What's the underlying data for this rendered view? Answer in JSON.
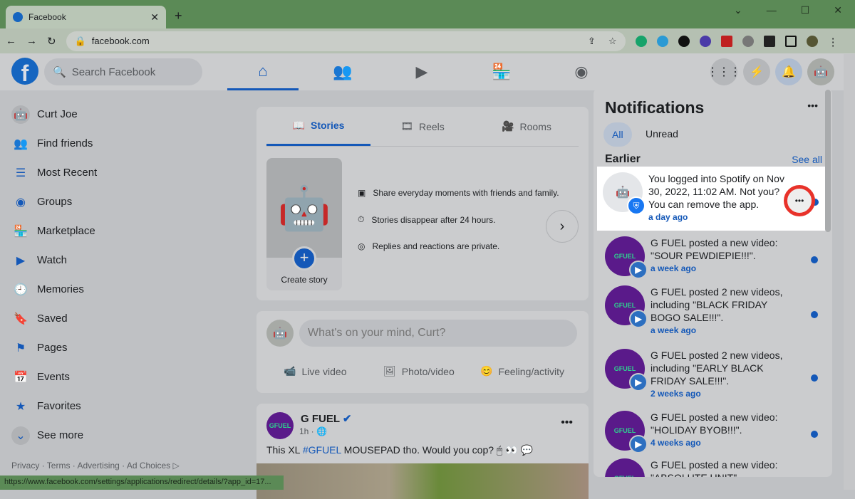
{
  "browser": {
    "tab_title": "Facebook",
    "url": "facebook.com",
    "status_url": "https://www.facebook.com/settings/applications/redirect/details/?app_id=17..."
  },
  "header": {
    "search_placeholder": "Search Facebook"
  },
  "sidebar": {
    "items": [
      {
        "label": "Curt Joe",
        "icon": "avatar"
      },
      {
        "label": "Find friends",
        "icon": "friends-icon"
      },
      {
        "label": "Most Recent",
        "icon": "feed-icon"
      },
      {
        "label": "Groups",
        "icon": "groups-icon"
      },
      {
        "label": "Marketplace",
        "icon": "marketplace-icon"
      },
      {
        "label": "Watch",
        "icon": "watch-icon"
      },
      {
        "label": "Memories",
        "icon": "clock-icon"
      },
      {
        "label": "Saved",
        "icon": "bookmark-icon"
      },
      {
        "label": "Pages",
        "icon": "flag-icon"
      },
      {
        "label": "Events",
        "icon": "calendar-icon"
      },
      {
        "label": "Favorites",
        "icon": "star-icon"
      },
      {
        "label": "See more",
        "icon": "chevron-down-icon"
      }
    ],
    "footer": "Privacy · Terms · Advertising · Ad Choices ▷"
  },
  "stories": {
    "tabs": [
      "Stories",
      "Reels",
      "Rooms"
    ],
    "create_label": "Create story",
    "tips": [
      "Share everyday moments with friends and family.",
      "Stories disappear after 24 hours.",
      "Replies and reactions are private."
    ]
  },
  "composer": {
    "placeholder": "What's on your mind, Curt?",
    "actions": [
      "Live video",
      "Photo/video",
      "Feeling/activity"
    ]
  },
  "post": {
    "author": "G FUEL",
    "time": "1h ·",
    "text_pre": "This XL ",
    "hashtag": "#GFUEL",
    "text_post": " MOUSEPAD tho. Would you cop? 🖱 👀 💬"
  },
  "notifications": {
    "title": "Notifications",
    "filters": [
      "All",
      "Unread"
    ],
    "section": "Earlier",
    "see_all": "See all",
    "items": [
      {
        "text": "You logged into Spotify on Nov 30, 2022, 11:02 AM. Not you? You can remove the app.",
        "time": "a day ago"
      },
      {
        "text": "G FUEL posted a new video: \"SOUR PEWDIEPIE!!!\".",
        "time": "a week ago"
      },
      {
        "text": "G FUEL posted 2 new videos, including \"BLACK FRIDAY BOGO SALE!!!\".",
        "time": "a week ago"
      },
      {
        "text": "G FUEL posted 2 new videos, including \"EARLY BLACK FRIDAY SALE!!!\".",
        "time": "2 weeks ago"
      },
      {
        "text": "G FUEL posted a new video: \"HOLIDAY BYOB!!!\".",
        "time": "4 weeks ago"
      },
      {
        "text": "G FUEL posted a new video: \"ABSOLUTE UNIT\"",
        "time": ""
      }
    ]
  }
}
